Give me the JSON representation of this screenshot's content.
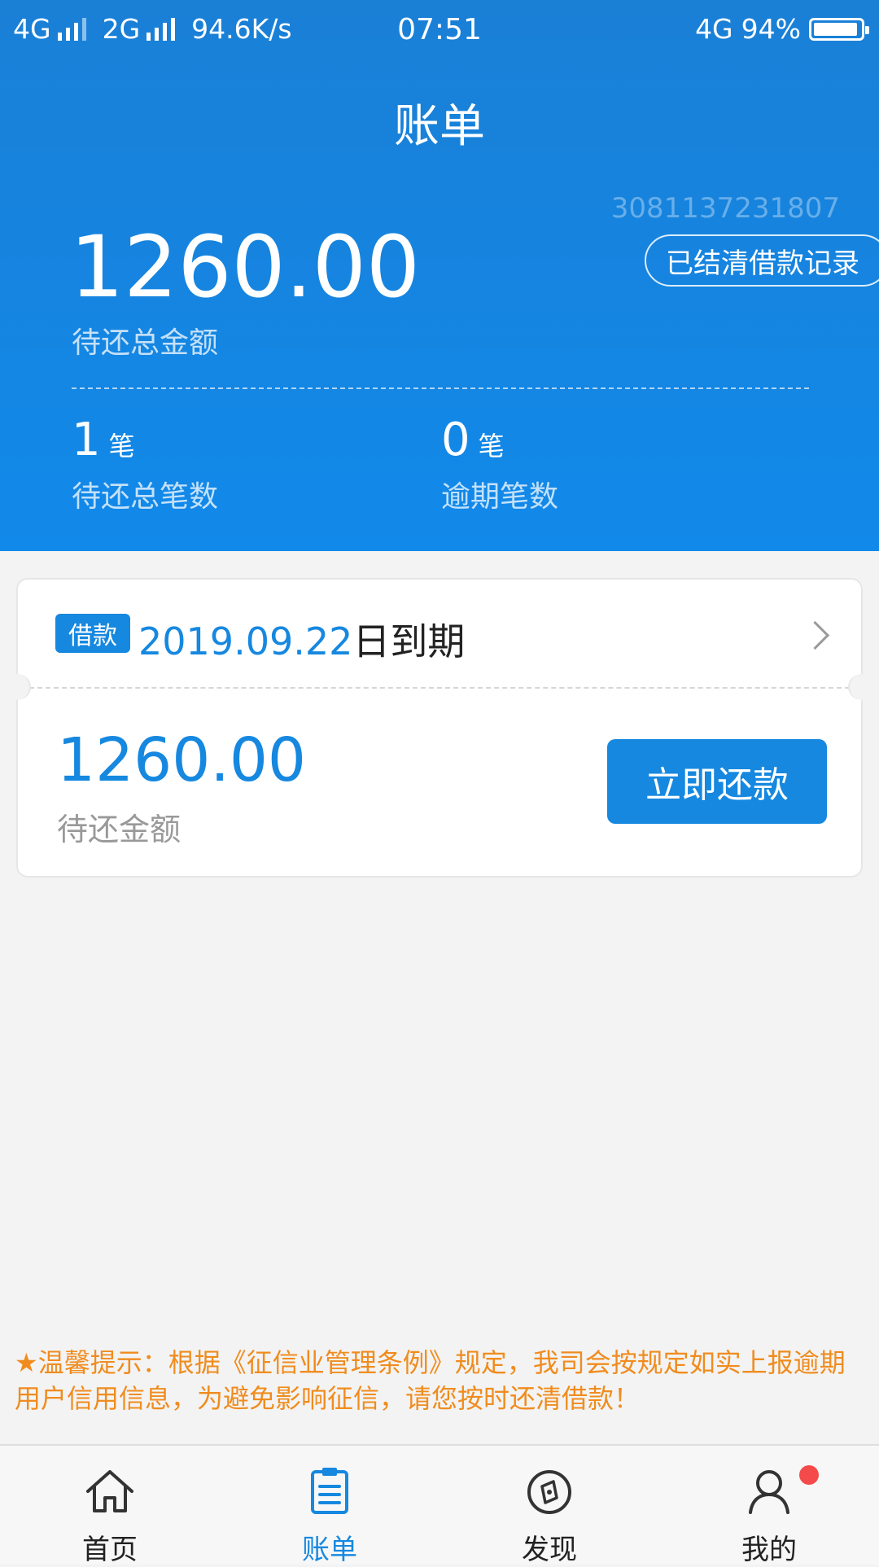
{
  "status_bar": {
    "network1": "4G",
    "network2": "2G",
    "speed": "94.6K/s",
    "time": "07:51",
    "network3": "4G",
    "battery_text": "94%",
    "battery_level": 0.94
  },
  "header": {
    "title": "账单",
    "account_no": "3081137231807",
    "settled_button": "已结清借款记录",
    "total_amount": "1260.00",
    "total_label": "待还总金额",
    "stats": [
      {
        "num": "1",
        "unit": "笔",
        "label": "待还总笔数"
      },
      {
        "num": "0",
        "unit": "笔",
        "label": "逾期笔数"
      }
    ]
  },
  "loan_card": {
    "tag": "借款",
    "due_date": "2019.09.22",
    "due_suffix": "日到期",
    "amount": "1260.00",
    "amount_label": "待还金额",
    "repay_button": "立即还款"
  },
  "tip": "★温馨提示：根据《征信业管理条例》规定，我司会按规定如实上报逾期用户信用信息，为避免影响征信，请您按时还清借款！",
  "tabs": [
    {
      "label": "首页",
      "icon": "home-icon"
    },
    {
      "label": "账单",
      "icon": "bill-icon"
    },
    {
      "label": "发现",
      "icon": "compass-icon"
    },
    {
      "label": "我的",
      "icon": "user-icon"
    }
  ],
  "colors": {
    "primary": "#1688e0",
    "header_top": "#1a80d6",
    "tip": "#f08c1e",
    "badge": "#f54a4a"
  }
}
